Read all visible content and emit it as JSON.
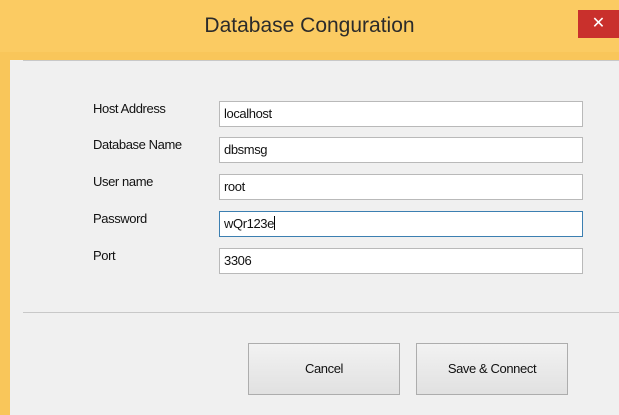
{
  "window": {
    "title": "Database Conguration",
    "close_glyph": "✕",
    "title_bar_color": "#fbcb62",
    "close_color": "#c9302c"
  },
  "form": {
    "host_label": "Host Address",
    "host_value": "localhost",
    "dbname_label": "Database Name",
    "dbname_value": "dbsmsg",
    "user_label": "User name",
    "user_value": "root",
    "password_label": "Password",
    "password_value": "wQr123e",
    "port_label": "Port",
    "port_value": "3306"
  },
  "buttons": {
    "cancel_label": "Cancel",
    "save_label": "Save & Connect"
  },
  "icons": {
    "close": "close-icon"
  }
}
